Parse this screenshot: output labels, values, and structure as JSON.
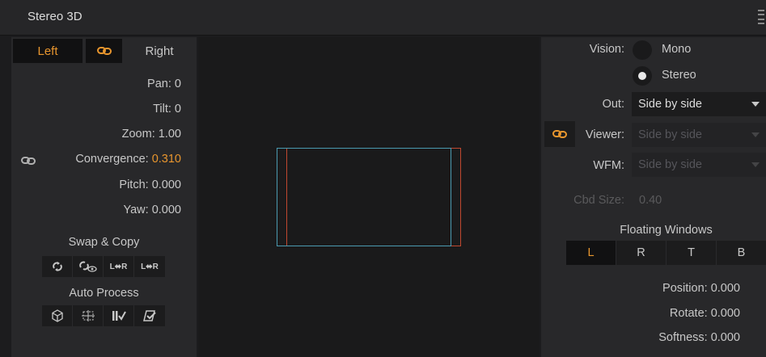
{
  "window": {
    "title": "Stereo 3D"
  },
  "eye_tabs": {
    "left": "Left",
    "right": "Right"
  },
  "params": {
    "pan": {
      "label": "Pan:",
      "value": "0"
    },
    "tilt": {
      "label": "Tilt:",
      "value": "0"
    },
    "zoom": {
      "label": "Zoom:",
      "value": "1.00"
    },
    "convergence": {
      "label": "Convergence:",
      "value": "0.310"
    },
    "pitch": {
      "label": "Pitch:",
      "value": "0.000"
    },
    "yaw": {
      "label": "Yaw:",
      "value": "0.000"
    }
  },
  "swap_copy": {
    "label": "Swap & Copy",
    "lr1": "L⬌R",
    "lr2": "L⬌R"
  },
  "auto_process": {
    "label": "Auto Process"
  },
  "vision": {
    "label": "Vision:",
    "mono": "Mono",
    "stereo": "Stereo",
    "selected": "Stereo"
  },
  "out": {
    "label": "Out:",
    "value": "Side by side"
  },
  "viewer": {
    "label": "Viewer:",
    "value": "Side by side"
  },
  "wfm": {
    "label": "WFM:",
    "value": "Side by side"
  },
  "cbd_size": {
    "label": "Cbd Size:",
    "value": "0.40"
  },
  "floating_windows": {
    "label": "Floating Windows",
    "tabs": [
      "L",
      "R",
      "T",
      "B"
    ],
    "active": "L",
    "position": {
      "label": "Position:",
      "value": "0.000"
    },
    "rotate": {
      "label": "Rotate:",
      "value": "0.000"
    },
    "softness": {
      "label": "Softness:",
      "value": "0.000"
    }
  },
  "colors": {
    "accent": "#e8962e",
    "left_eye_frame": "#4a9ab0",
    "right_eye_frame": "#c04830"
  }
}
